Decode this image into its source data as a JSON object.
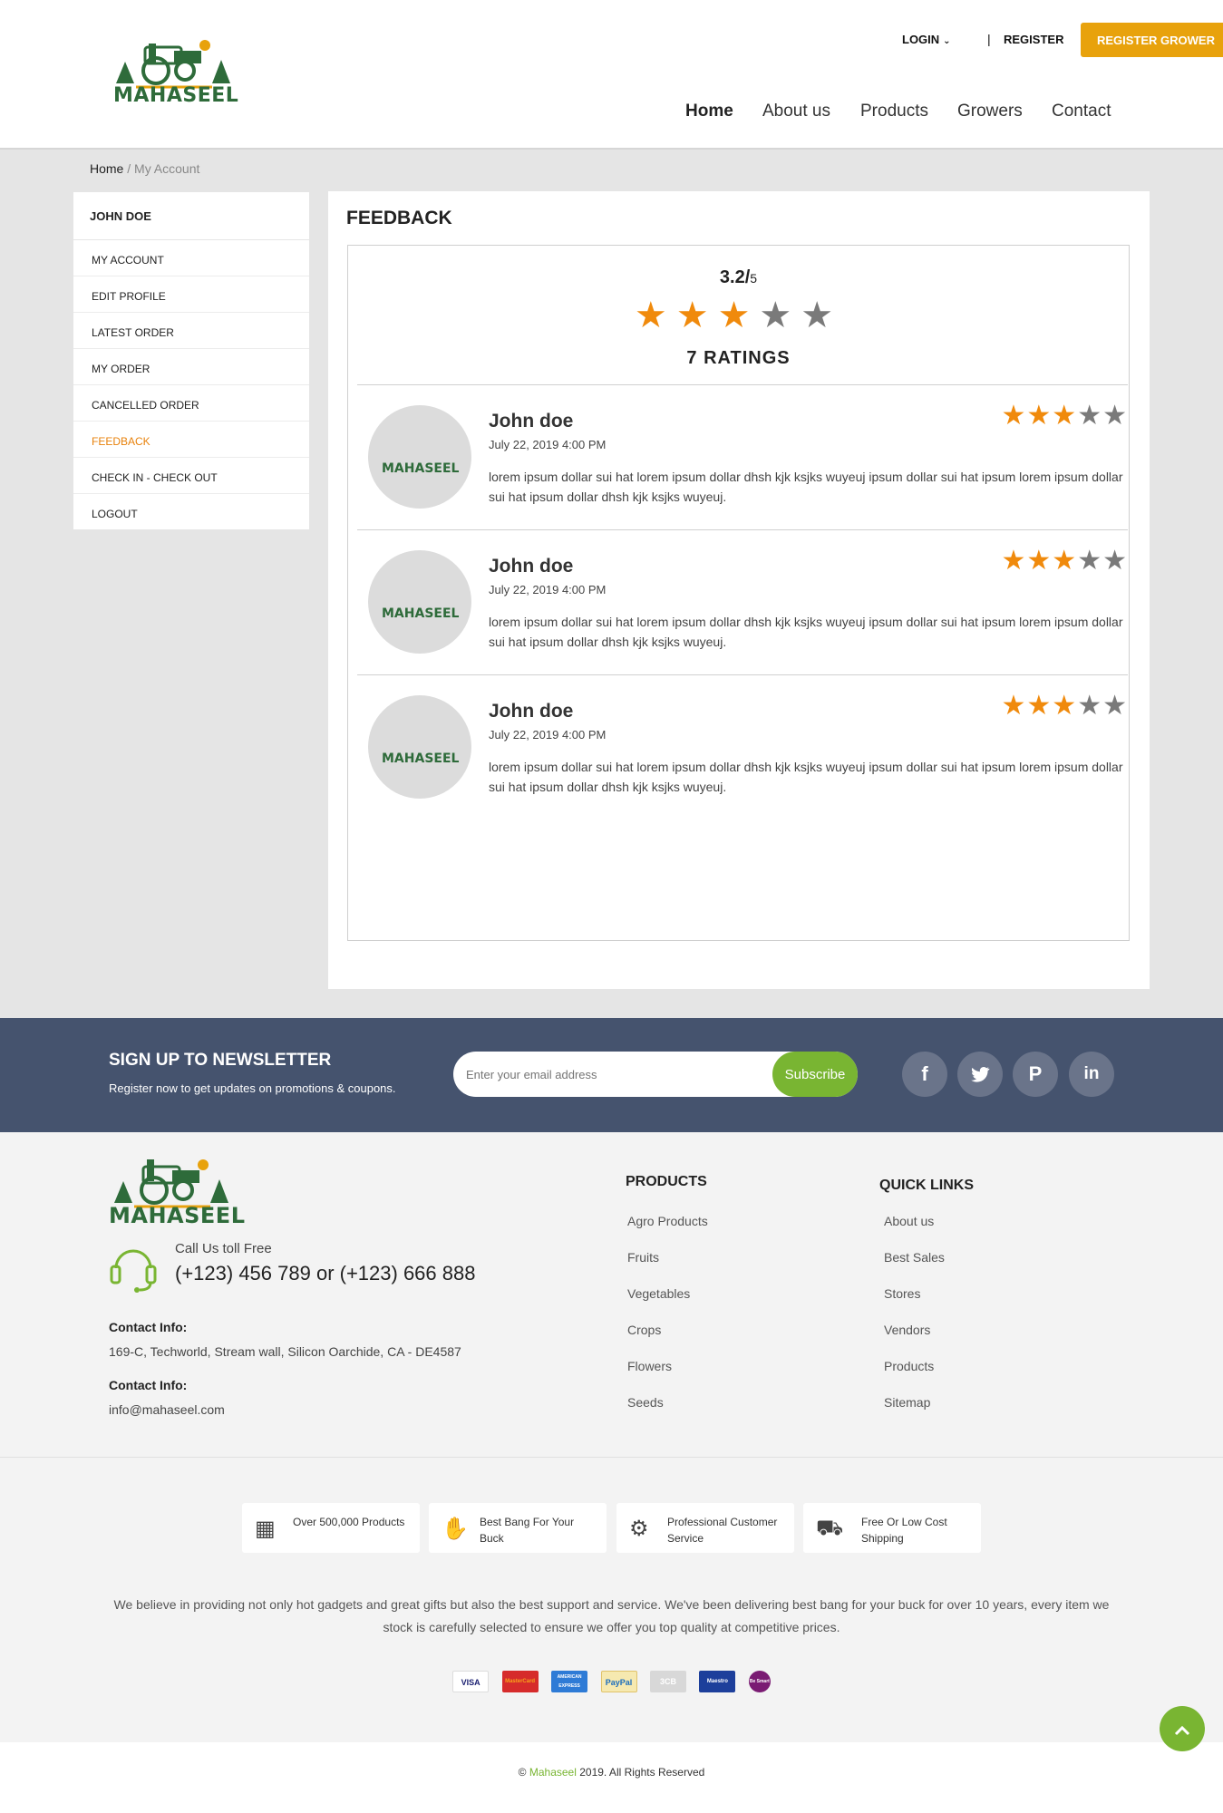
{
  "brand": {
    "name": "MAHASEEL",
    "copyright_prefix": "©",
    "copyright_brand": "Mahaseel",
    "copyright_suffix": "2019. All Rights Reserved"
  },
  "header": {
    "login": "LOGIN",
    "separator": "|",
    "register": "REGISTER",
    "register_grower": "REGISTER GROWER",
    "nav": [
      "Home",
      "About us",
      "Products",
      "Growers",
      "Contact"
    ]
  },
  "breadcrumb": {
    "home": "Home",
    "separator": " / ",
    "current": "My Account"
  },
  "sidebar": {
    "user": "JOHN DOE",
    "items": [
      "MY ACCOUNT",
      "EDIT PROFILE",
      "LATEST ORDER",
      "MY ORDER",
      "CANCELLED ORDER",
      "FEEDBACK",
      "CHECK IN - CHECK OUT",
      "LOGOUT"
    ],
    "active": "FEEDBACK"
  },
  "feedback": {
    "title": "FEEDBACK",
    "score": "3.2/",
    "score_max": "5",
    "rating_stars": 3,
    "ratings_count": "7 RATINGS",
    "reviews": [
      {
        "name": "John doe",
        "date": "July 22, 2019 4:00 PM",
        "stars": 3,
        "text": "lorem ipsum dollar sui hat lorem ipsum dollar dhsh kjk ksjks wuyeuj ipsum dollar sui hat ipsum lorem ipsum dollar sui hat ipsum dollar dhsh kjk ksjks wuyeuj."
      },
      {
        "name": "John doe",
        "date": "July 22, 2019 4:00 PM",
        "stars": 3,
        "text": "lorem ipsum dollar sui hat lorem ipsum dollar dhsh kjk ksjks wuyeuj ipsum dollar sui hat ipsum lorem ipsum dollar sui hat ipsum dollar dhsh kjk ksjks wuyeuj."
      },
      {
        "name": "John doe",
        "date": "July 22, 2019 4:00 PM",
        "stars": 3,
        "text": "lorem ipsum dollar sui hat lorem ipsum dollar dhsh kjk ksjks wuyeuj ipsum dollar sui hat ipsum lorem ipsum dollar sui hat ipsum dollar dhsh kjk ksjks wuyeuj."
      }
    ]
  },
  "newsletter": {
    "title": "SIGN UP TO NEWSLETTER",
    "subtitle": "Register now to get updates on promotions & coupons.",
    "placeholder": "Enter your email address",
    "button": "Subscribe",
    "social": [
      "facebook-icon",
      "twitter-icon",
      "pinterest-icon",
      "linkedin-icon"
    ]
  },
  "footer": {
    "call_label": "Call Us toll Free",
    "call_number": "(+123) 456 789 or (+123) 666 888",
    "contact_label_1": "Contact Info:",
    "address": "169-C, Techworld, Stream wall, Silicon Oarchide, CA - DE4587",
    "contact_label_2": "Contact Info:",
    "email": "info@mahaseel.com",
    "products_title": "PRODUCTS",
    "products": [
      "Agro Products",
      "Fruits",
      "Vegetables",
      "Crops",
      "Flowers",
      "Seeds"
    ],
    "quick_title": "QUICK LINKS",
    "quick_links": [
      "About us",
      "Best Sales",
      "Stores",
      "Vendors",
      "Products",
      "Sitemap"
    ]
  },
  "features": [
    {
      "icon": "products-icon",
      "text": "Over 500,000 Products"
    },
    {
      "icon": "money-bag-icon",
      "text": "Best Bang For Your Buck"
    },
    {
      "icon": "team-icon",
      "text": "Professional Customer Service"
    },
    {
      "icon": "truck-icon",
      "text": "Free Or Low Cost Shipping"
    }
  ],
  "about_text": "We believe in providing not only hot gadgets and great gifts but also the best support and service. We've been delivering best bang for your buck for over 10 years, every item we stock is carefully selected to ensure we offer you top quality at competitive prices.",
  "payment_cards": [
    "VISA",
    "MasterCard",
    "AMERICAN EXPRESS",
    "PayPal",
    "3CB",
    "Maestro",
    "Be Smart"
  ],
  "colors": {
    "accent_orange": "#f08a0c",
    "grower_button": "#e8a20c",
    "green": "#79b532",
    "newsletter_bg": "#45536e"
  }
}
